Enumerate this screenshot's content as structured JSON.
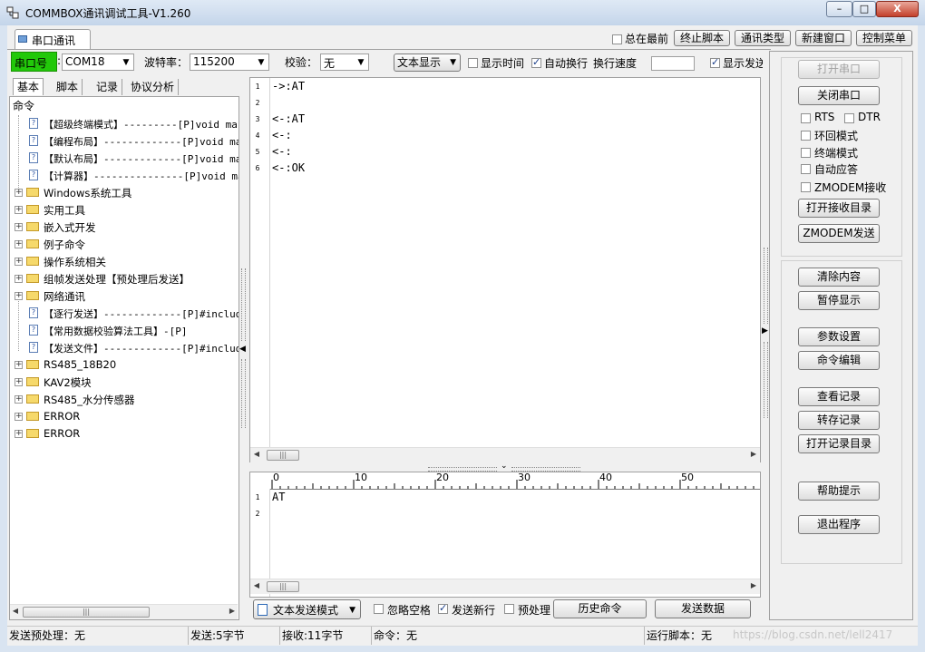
{
  "window": {
    "title": "COMMBOX通讯调试工具-V1.260",
    "min_label": "–",
    "max_label": "□",
    "close_label": "X"
  },
  "doc_tab": {
    "label": "串口通讯"
  },
  "top_right": {
    "always_on_top": "总在最前",
    "stop_script": "终止脚本",
    "comm_type": "通讯类型",
    "new_window": "新建窗口",
    "control_menu": "控制菜单"
  },
  "toolbar": {
    "port_label": "串口号",
    "port_value": "COM18",
    "baud_label": "波特率：",
    "baud_value": "115200",
    "parity_label": "校验：",
    "parity_value": "无",
    "display_mode": "文本显示",
    "show_time": "显示时间",
    "auto_wrap": "自动换行",
    "wrap_speed_label": "换行速度",
    "wrap_speed_value": "",
    "show_send": "显示发送"
  },
  "left_tabs": [
    "基本",
    "脚本",
    "记录",
    "协议分析"
  ],
  "tree_header": "命令",
  "tree": [
    {
      "type": "doc",
      "text": "【超级终端模式】---------[P]void ma"
    },
    {
      "type": "doc",
      "text": "【编程布局】-------------[P]void ma"
    },
    {
      "type": "doc",
      "text": "【默认布局】-------------[P]void ma"
    },
    {
      "type": "doc",
      "text": "【计算器】---------------[P]void ma"
    },
    {
      "type": "folder",
      "text": "Windows系统工具"
    },
    {
      "type": "folder",
      "text": "实用工具"
    },
    {
      "type": "folder",
      "text": "嵌入式开发"
    },
    {
      "type": "folder",
      "text": "例子命令"
    },
    {
      "type": "folder",
      "text": "操作系统相关"
    },
    {
      "type": "folder",
      "text": "组帧发送处理【预处理后发送】"
    },
    {
      "type": "folder",
      "text": "网络通讯"
    },
    {
      "type": "doc",
      "text": "【逐行发送】-------------[P]#includ"
    },
    {
      "type": "doc",
      "text": "【常用数据校验算法工具】-[P]"
    },
    {
      "type": "doc",
      "text": "【发送文件】-------------[P]#includ"
    },
    {
      "type": "folder",
      "text": "RS485_18B20"
    },
    {
      "type": "folder",
      "text": "KAV2模块"
    },
    {
      "type": "folder",
      "text": "RS485_水分传感器"
    },
    {
      "type": "folder",
      "text": "ERROR"
    },
    {
      "type": "folder",
      "text": "ERROR"
    }
  ],
  "receive_lines": [
    {
      "n": "1",
      "text": "->:AT"
    },
    {
      "n": "2",
      "text": ""
    },
    {
      "n": "3",
      "text": "<-:AT"
    },
    {
      "n": "4",
      "text": "<-:"
    },
    {
      "n": "5",
      "text": "<-:"
    },
    {
      "n": "6",
      "text": "<-:OK"
    }
  ],
  "ruler_ticks": [
    "0",
    "10",
    "20",
    "30",
    "40",
    "50"
  ],
  "send_lines": [
    {
      "n": "1",
      "text": "AT"
    },
    {
      "n": "2",
      "text": ""
    }
  ],
  "bottom_bar": {
    "send_mode": "文本发送模式",
    "ignore_space": "忽略空格",
    "send_newline": "发送新行",
    "preprocess": "预处理",
    "history": "历史命令",
    "send": "发送数据"
  },
  "right_panel": {
    "open_port": "打开串口",
    "close_port": "关闭串口",
    "rts": "RTS",
    "dtr": "DTR",
    "loopback": "环回模式",
    "terminal": "终端模式",
    "auto_reply": "自动应答",
    "zmodem_recv": "ZMODEM接收",
    "open_recv_dir": "打开接收目录",
    "zmodem_send": "ZMODEM发送",
    "clear": "清除内容",
    "pause": "暂停显示",
    "params": "参数设置",
    "cmd_edit": "命令编辑",
    "view_log": "查看记录",
    "save_log": "转存记录",
    "open_log_dir": "打开记录目录",
    "help": "帮助提示",
    "exit": "退出程序"
  },
  "status_bar": {
    "preprocess": "发送预处理：无",
    "sent": "发送:5字节",
    "received": "接收:11字节",
    "command": "命令：无",
    "script": "运行脚本：无",
    "watermark": "https://blog.csdn.net/lell2417"
  },
  "colors": {
    "port_label_bg": "#22c80a",
    "tab_accent": "#3a6ea5"
  }
}
